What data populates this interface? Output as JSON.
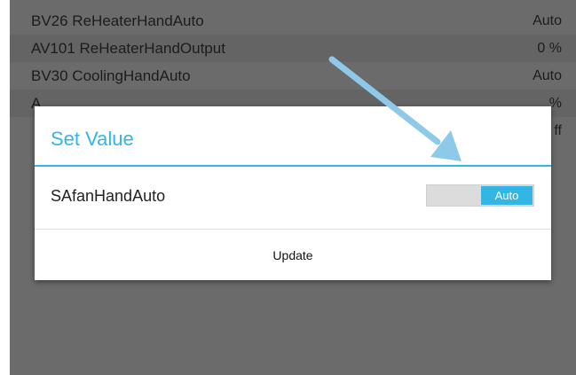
{
  "list": {
    "rows": [
      {
        "name": "BV26  ReHeaterHandAuto",
        "value": "Auto"
      },
      {
        "name": "AV101  ReHeaterHandOutput",
        "value": "0 %"
      },
      {
        "name": "BV30  CoolingHandAuto",
        "value": "Auto"
      },
      {
        "name": "A",
        "value": "%"
      },
      {
        "name": "",
        "value": "ff"
      }
    ]
  },
  "dialog": {
    "title": "Set Value",
    "field_label": "SAfanHandAuto",
    "toggle_value": "Auto",
    "update_label": "Update"
  },
  "colors": {
    "accent": "#33b5e5",
    "annotation_arrow": "#8ec9ea"
  },
  "annotation": {
    "icon": "arrow-annotation-icon"
  }
}
